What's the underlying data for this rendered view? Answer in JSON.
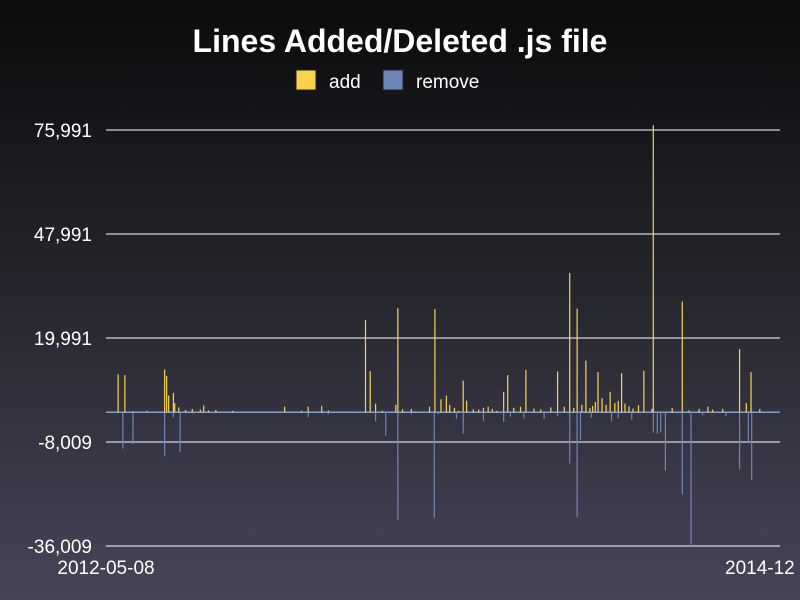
{
  "chart_data": {
    "type": "bar",
    "title": "Lines Added/Deleted .js file",
    "legend_position": "top-center",
    "grid": true,
    "ylim": [
      -36009,
      75991
    ],
    "y_ticks": [
      {
        "value": 75991,
        "label": "75,991"
      },
      {
        "value": 47991,
        "label": "47,991"
      },
      {
        "value": 19991,
        "label": "19,991"
      },
      {
        "value": -8009,
        "label": "-8,009"
      },
      {
        "value": -36009,
        "label": "-36,009"
      }
    ],
    "x_ticks": [
      {
        "value": 0,
        "label": "2012-05-08"
      },
      {
        "value": 1,
        "label": "2014-12"
      }
    ],
    "x_range": [
      0,
      1
    ],
    "series": [
      {
        "name": "add",
        "color": "#f9d34e",
        "points": [
          [
            0.018,
            10200
          ],
          [
            0.028,
            10000
          ],
          [
            0.04,
            300
          ],
          [
            0.061,
            400
          ],
          [
            0.087,
            11500
          ],
          [
            0.09,
            9800
          ],
          [
            0.093,
            4500
          ],
          [
            0.1,
            5200
          ],
          [
            0.102,
            2500
          ],
          [
            0.108,
            1300
          ],
          [
            0.118,
            600
          ],
          [
            0.128,
            900
          ],
          [
            0.14,
            700
          ],
          [
            0.145,
            1800
          ],
          [
            0.152,
            500
          ],
          [
            0.163,
            600
          ],
          [
            0.188,
            400
          ],
          [
            0.265,
            1500
          ],
          [
            0.29,
            400
          ],
          [
            0.3,
            1500
          ],
          [
            0.32,
            1700
          ],
          [
            0.33,
            500
          ],
          [
            0.385,
            24800
          ],
          [
            0.392,
            11100
          ],
          [
            0.4,
            2300
          ],
          [
            0.41,
            400
          ],
          [
            0.43,
            2000
          ],
          [
            0.433,
            28000
          ],
          [
            0.44,
            800
          ],
          [
            0.453,
            900
          ],
          [
            0.46,
            200
          ],
          [
            0.48,
            1500
          ],
          [
            0.488,
            27800
          ],
          [
            0.497,
            3500
          ],
          [
            0.505,
            4500
          ],
          [
            0.51,
            2000
          ],
          [
            0.517,
            1200
          ],
          [
            0.523,
            400
          ],
          [
            0.53,
            8500
          ],
          [
            0.535,
            3100
          ],
          [
            0.545,
            800
          ],
          [
            0.553,
            700
          ],
          [
            0.56,
            1200
          ],
          [
            0.567,
            1500
          ],
          [
            0.573,
            900
          ],
          [
            0.58,
            400
          ],
          [
            0.59,
            5500
          ],
          [
            0.596,
            10000
          ],
          [
            0.605,
            1200
          ],
          [
            0.615,
            1500
          ],
          [
            0.623,
            11400
          ],
          [
            0.635,
            1000
          ],
          [
            0.645,
            800
          ],
          [
            0.66,
            1300
          ],
          [
            0.67,
            11000
          ],
          [
            0.68,
            1500
          ],
          [
            0.688,
            37500
          ],
          [
            0.694,
            1200
          ],
          [
            0.699,
            27900
          ],
          [
            0.706,
            2000
          ],
          [
            0.712,
            13900
          ],
          [
            0.718,
            1100
          ],
          [
            0.722,
            1700
          ],
          [
            0.726,
            2800
          ],
          [
            0.73,
            10800
          ],
          [
            0.736,
            3800
          ],
          [
            0.742,
            2000
          ],
          [
            0.748,
            5500
          ],
          [
            0.755,
            2500
          ],
          [
            0.76,
            3000
          ],
          [
            0.765,
            10500
          ],
          [
            0.77,
            2300
          ],
          [
            0.776,
            1600
          ],
          [
            0.782,
            1000
          ],
          [
            0.79,
            1900
          ],
          [
            0.798,
            11200
          ],
          [
            0.81,
            900
          ],
          [
            0.812,
            77300
          ],
          [
            0.84,
            1200
          ],
          [
            0.855,
            29800
          ],
          [
            0.865,
            500
          ],
          [
            0.88,
            900
          ],
          [
            0.893,
            1500
          ],
          [
            0.9,
            700
          ],
          [
            0.915,
            900
          ],
          [
            0.94,
            17000
          ],
          [
            0.95,
            2500
          ],
          [
            0.957,
            10800
          ],
          [
            0.97,
            900
          ]
        ]
      },
      {
        "name": "remove",
        "color": "#6d86b8",
        "points": [
          [
            0.025,
            -9800
          ],
          [
            0.04,
            -8600
          ],
          [
            0.06,
            -200
          ],
          [
            0.087,
            -11900
          ],
          [
            0.1,
            -1400
          ],
          [
            0.11,
            -10700
          ],
          [
            0.13,
            -300
          ],
          [
            0.16,
            -300
          ],
          [
            0.265,
            -200
          ],
          [
            0.3,
            -1300
          ],
          [
            0.33,
            -500
          ],
          [
            0.373,
            -300
          ],
          [
            0.4,
            -2400
          ],
          [
            0.415,
            -6300
          ],
          [
            0.433,
            -28900
          ],
          [
            0.453,
            -500
          ],
          [
            0.487,
            -28400
          ],
          [
            0.493,
            -600
          ],
          [
            0.52,
            -1700
          ],
          [
            0.53,
            -5800
          ],
          [
            0.56,
            -2300
          ],
          [
            0.59,
            -2600
          ],
          [
            0.6,
            -1200
          ],
          [
            0.62,
            -1700
          ],
          [
            0.65,
            -1800
          ],
          [
            0.67,
            -1000
          ],
          [
            0.688,
            -13800
          ],
          [
            0.699,
            -28200
          ],
          [
            0.704,
            -7400
          ],
          [
            0.72,
            -1500
          ],
          [
            0.75,
            -2400
          ],
          [
            0.76,
            -1600
          ],
          [
            0.78,
            -2000
          ],
          [
            0.812,
            -5500
          ],
          [
            0.818,
            -5800
          ],
          [
            0.823,
            -5400
          ],
          [
            0.83,
            -15700
          ],
          [
            0.855,
            -22100
          ],
          [
            0.868,
            -36000
          ],
          [
            0.885,
            -800
          ],
          [
            0.92,
            -1000
          ],
          [
            0.94,
            -15400
          ],
          [
            0.953,
            -8000
          ],
          [
            0.958,
            -18300
          ]
        ]
      }
    ]
  }
}
